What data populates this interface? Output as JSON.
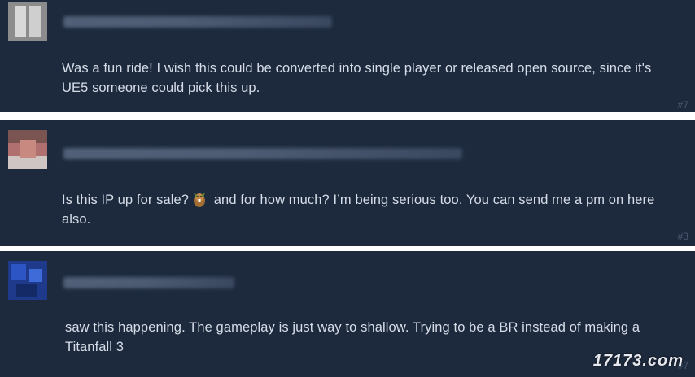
{
  "comments": [
    {
      "text": "Was a fun ride! I wish this could be converted into single player or released open source, since it's UE5 someone could pick this up.",
      "number": "#7"
    },
    {
      "text_before_emoji": "Is this IP up for sale?",
      "emoji_icon": "beaver-emoji",
      "text_after_emoji": " and for how much? I’m being serious too. You can send me a pm on here also.",
      "number": "#3"
    },
    {
      "text": "saw this happening. The gameplay is just way to shallow. Trying to be a BR instead of making a Titanfall 3",
      "number": "#7"
    }
  ],
  "watermark": "17173.com",
  "colors": {
    "comment_bg": "#1d2a3d",
    "text": "#d6dde8",
    "number": "#4a5870",
    "separator": "#ffffff"
  }
}
